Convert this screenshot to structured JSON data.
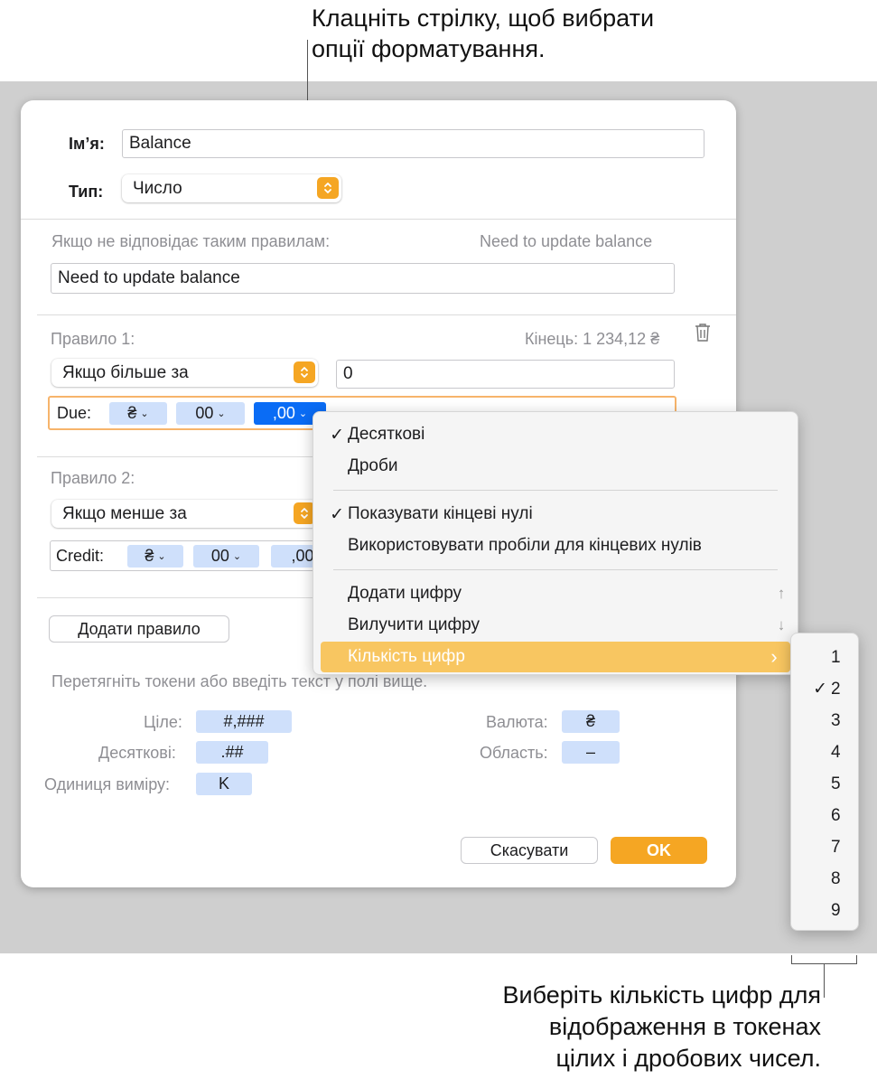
{
  "callouts": {
    "top": [
      "Клацніть стрілку, щоб вибрати",
      "опції форматування."
    ],
    "bottom": [
      "Виберіть кількість цифр для",
      "відображення в токенах",
      "цілих і дробових чисел."
    ]
  },
  "dialog": {
    "name_label": "Ім’я:",
    "name_value": "Balance",
    "type_label": "Тип:",
    "type_value": "Число",
    "no_match_label": "Якщо не відповідає таким правилам:",
    "no_match_preview": "Need to update balance",
    "no_match_value": "Need to update balance",
    "rule1": {
      "label": "Правило 1:",
      "preview": "Кінець: 1 234,12 ₴",
      "condition": "Якщо більше за",
      "value": "0",
      "prefix": "Due:",
      "tokens": [
        "₴",
        "00",
        ",00"
      ]
    },
    "rule2": {
      "label": "Правило 2:",
      "condition": "Якщо менше за",
      "prefix": "Credit:",
      "tokens": [
        "₴",
        "00",
        ",00"
      ]
    },
    "add_rule_button": "Додати правило",
    "hint": "Перетягніть токени або введіть текст у полі вище.",
    "token_legend": {
      "integer_label": "Ціле:",
      "integer_token": "#,###",
      "decimal_label": "Десяткові:",
      "decimal_token": ".##",
      "unit_label": "Одиниця виміру:",
      "unit_token": "K",
      "currency_label": "Валюта:",
      "currency_token": "₴",
      "scope_label": "Область:",
      "scope_token": "–"
    },
    "cancel_button": "Скасувати",
    "ok_button": "OK"
  },
  "menu": {
    "items": [
      {
        "label": "Десяткові",
        "checked": "✓"
      },
      {
        "label": "Дроби",
        "checked": ""
      },
      {
        "label": "Показувати кінцеві нулі",
        "checked": "✓"
      },
      {
        "label": "Використовувати пробіли для кінцевих нулів",
        "checked": ""
      },
      {
        "label": "Додати цифру",
        "shortcut": "↑"
      },
      {
        "label": "Вилучити цифру",
        "shortcut": "↓"
      },
      {
        "label": "Кількість цифр",
        "submenu_arrow": "›"
      }
    ]
  },
  "submenu": {
    "items": [
      "1",
      "2",
      "3",
      "4",
      "5",
      "6",
      "7",
      "8",
      "9"
    ],
    "selected_mark": "✓"
  },
  "colors": {
    "accent": "#f5a623",
    "token": "#cfe0fb",
    "token_selected": "#0a6cf5",
    "menu_highlight": "#f8c661"
  }
}
